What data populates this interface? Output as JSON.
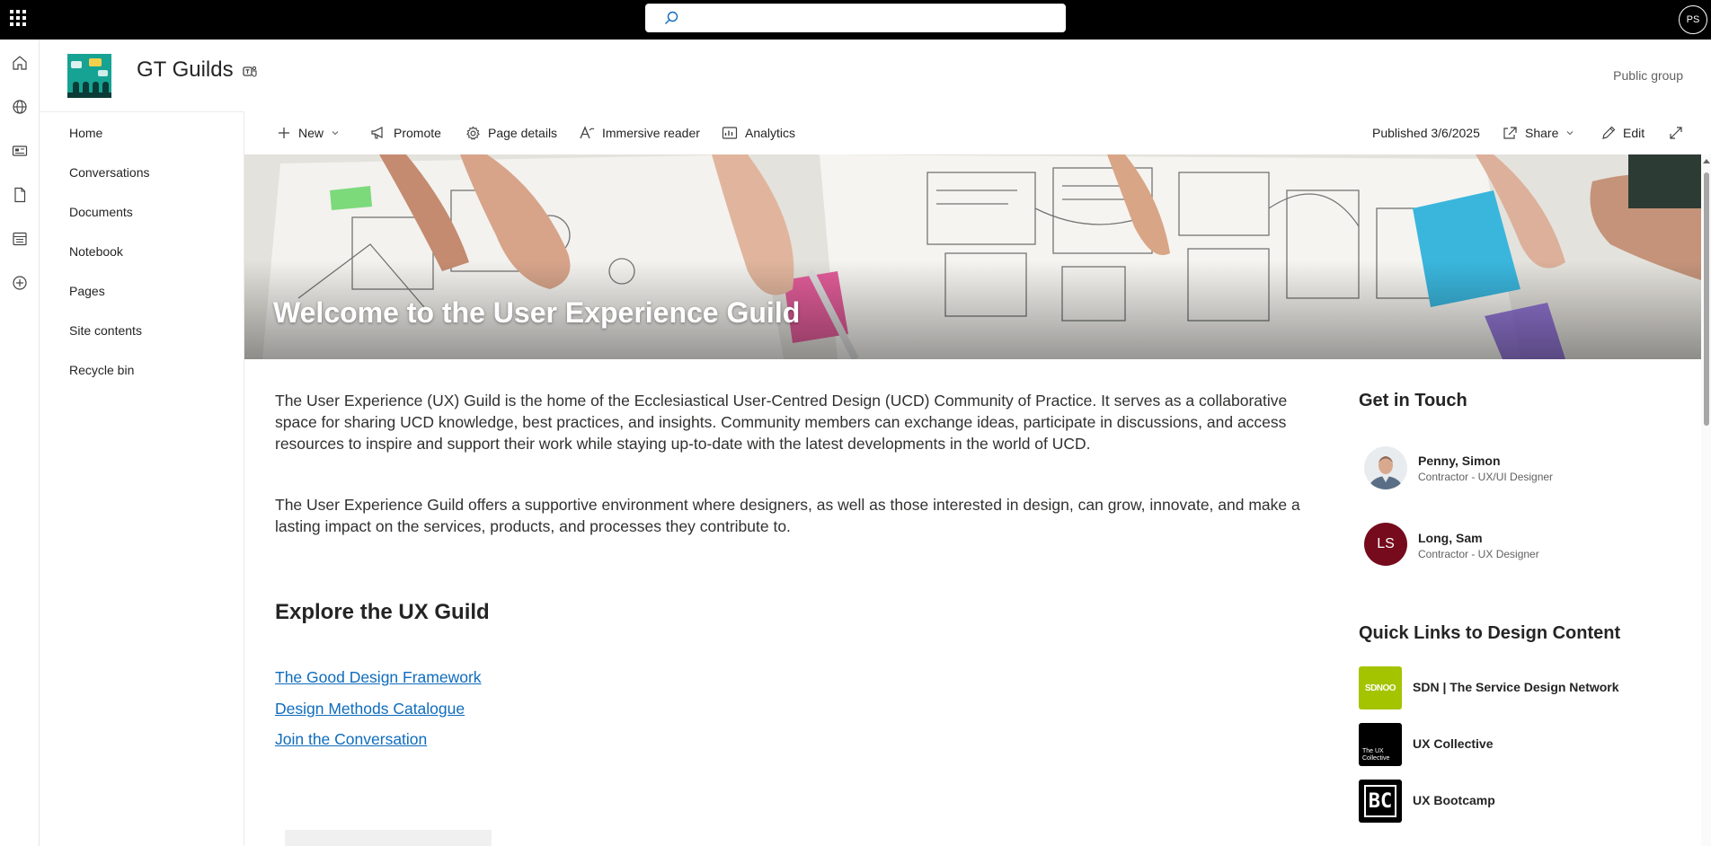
{
  "topbar": {
    "user_initials": "PS"
  },
  "site": {
    "title": "GT Guilds",
    "group_type": "Public group"
  },
  "nav": [
    {
      "label": "Home"
    },
    {
      "label": "Conversations"
    },
    {
      "label": "Documents"
    },
    {
      "label": "Notebook"
    },
    {
      "label": "Pages"
    },
    {
      "label": "Site contents"
    },
    {
      "label": "Recycle bin"
    }
  ],
  "commands": {
    "new": "New",
    "promote": "Promote",
    "page_details": "Page details",
    "immersive_reader": "Immersive reader",
    "analytics": "Analytics",
    "published": "Published 3/6/2025",
    "share": "Share",
    "edit": "Edit"
  },
  "hero": {
    "title": "Welcome to the User Experience Guild"
  },
  "content": {
    "para1": "The User Experience (UX) Guild is the home of the Ecclesiastical User-Centred Design (UCD) Community of Practice. It serves as a collaborative space for sharing UCD knowledge, best practices, and insights. Community members can exchange ideas, participate in discussions, and access resources to inspire and support their work while staying up-to-date with the latest developments in the world of UCD.",
    "para2": "The User Experience Guild offers a supportive environment where designers, as well as those interested in design, can grow, innovate, and make a lasting impact on the services, products, and processes they contribute to.",
    "explore_heading": "Explore the UX Guild",
    "links": [
      {
        "label": "The Good Design Framework"
      },
      {
        "label": "Design Methods Catalogue"
      },
      {
        "label": "Join the Conversation"
      }
    ]
  },
  "sidebar": {
    "get_in_touch": "Get in Touch",
    "people": [
      {
        "name": "Penny, Simon",
        "role": "Contractor - UX/UI Designer"
      },
      {
        "name": "Long, Sam",
        "role": "Contractor - UX Designer",
        "initials": "LS",
        "color": "#750b1c"
      }
    ],
    "quick_links_heading": "Quick Links to Design Content",
    "quick_links": [
      {
        "label": "SDN | The Service Design Network",
        "thumb_text": "SDNOO",
        "color": "#a4c400"
      },
      {
        "label": "UX Collective",
        "thumb_text": "The UX Collective",
        "color": "#000000"
      },
      {
        "label": "UX Bootcamp",
        "thumb_text": "BC",
        "color": "#000000"
      }
    ]
  },
  "colors": {
    "accent": "#0f6cbd",
    "topbar": "#000000"
  }
}
